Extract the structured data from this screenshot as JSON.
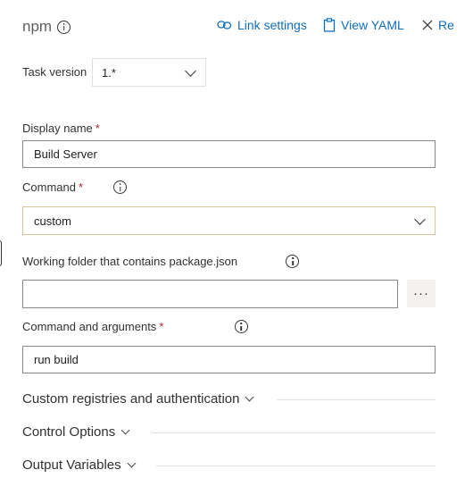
{
  "header": {
    "title": "npm",
    "link_settings": "Link settings",
    "view_yaml": "View YAML",
    "remove": "Re"
  },
  "form": {
    "task_version_label": "Task version",
    "task_version_value": "1.*",
    "display_name_label": "Display name",
    "display_name_value": "Build Server",
    "command_label": "Command",
    "command_value": "custom",
    "working_folder_label": "Working folder that contains package.json",
    "working_folder_value": "",
    "browse_label": "···",
    "args_label": "Command and arguments",
    "args_value": "run build",
    "required_mark": "*"
  },
  "sections": {
    "custom_registries": "Custom registries and authentication",
    "control_options": "Control Options",
    "output_variables": "Output Variables"
  },
  "icons": [
    "info-icon",
    "link-icon",
    "clipboard-icon",
    "close-icon",
    "chevron-down-icon"
  ]
}
